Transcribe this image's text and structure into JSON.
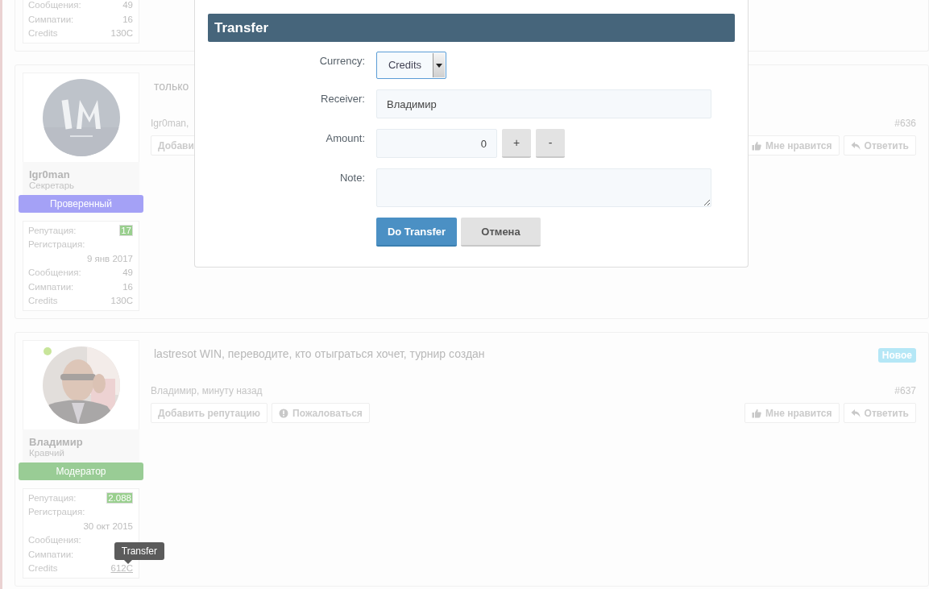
{
  "top_post": {
    "stats": [
      {
        "label": "Сообщения:",
        "value": "49"
      },
      {
        "label": "Симпатии:",
        "value": "16"
      },
      {
        "label": "Credits",
        "value": "130C",
        "hovered": false
      }
    ]
  },
  "posts": [
    {
      "author": "Igr0man",
      "role": "Секретарь",
      "online": false,
      "badge": {
        "text": "Проверенный",
        "color": "#a4a1f6"
      },
      "stats": [
        {
          "label": "Репутация:",
          "value": "17",
          "kind": "highlight"
        },
        {
          "label": "Регистрация:",
          "value": "9 янв 2017",
          "kind": "stacked"
        },
        {
          "label": "Сообщения:",
          "value": "49",
          "kind": "plain"
        },
        {
          "label": "Симпатии:",
          "value": "16",
          "kind": "plain"
        },
        {
          "label": "Credits",
          "value": "130C",
          "kind": "credit",
          "hovered": false
        }
      ],
      "message": "только",
      "meta": "Igr0man,",
      "number": "#636",
      "actions_left": [
        {
          "label": "Добави",
          "kind": "plain"
        }
      ],
      "actions_right": [
        {
          "label": "Мне нравится",
          "kind": "like"
        },
        {
          "label": "Ответить",
          "kind": "reply"
        }
      ]
    },
    {
      "author": "Владимир",
      "role": "Кравчий",
      "online": true,
      "badge": {
        "text": "Модератор",
        "color": "#99cc95"
      },
      "stats": [
        {
          "label": "Репутация:",
          "value": "2.088",
          "kind": "highlight"
        },
        {
          "label": "Регистрация:",
          "value": "30 окт 2015",
          "kind": "stacked"
        },
        {
          "label": "Сообщения:",
          "kind": "plain"
        },
        {
          "label": "Симпатии:",
          "kind": "plain"
        },
        {
          "label": "Credits",
          "value": "612C",
          "kind": "credit",
          "hovered": true,
          "tooltip": "Transfer"
        }
      ],
      "message": "lastresot WIN, переводите, кто отыграться хочет, турнир создан",
      "tag": "Новое",
      "meta": "Владимир, минуту назад",
      "number": "#637",
      "actions_left": [
        {
          "label": "Добавить репутацию",
          "kind": "plain"
        },
        {
          "label": "Пожаловаться",
          "kind": "alert"
        }
      ],
      "actions_right": [
        {
          "label": "Мне нравится",
          "kind": "like"
        },
        {
          "label": "Ответить",
          "kind": "reply"
        }
      ]
    }
  ],
  "dialog": {
    "title": "Transfer",
    "fields": [
      {
        "label": "Currency:",
        "kind": "select",
        "value": "Credits"
      },
      {
        "label": "Receiver:",
        "kind": "text",
        "value": "Владимир"
      },
      {
        "label": "Amount:",
        "kind": "amount",
        "value": "0",
        "steps": [
          "+",
          "-"
        ]
      },
      {
        "label": "Note:",
        "kind": "textarea"
      }
    ],
    "buttons": [
      {
        "label": "Do Transfer",
        "kind": "primary"
      },
      {
        "label": "Отмена",
        "kind": "secondary"
      }
    ]
  }
}
